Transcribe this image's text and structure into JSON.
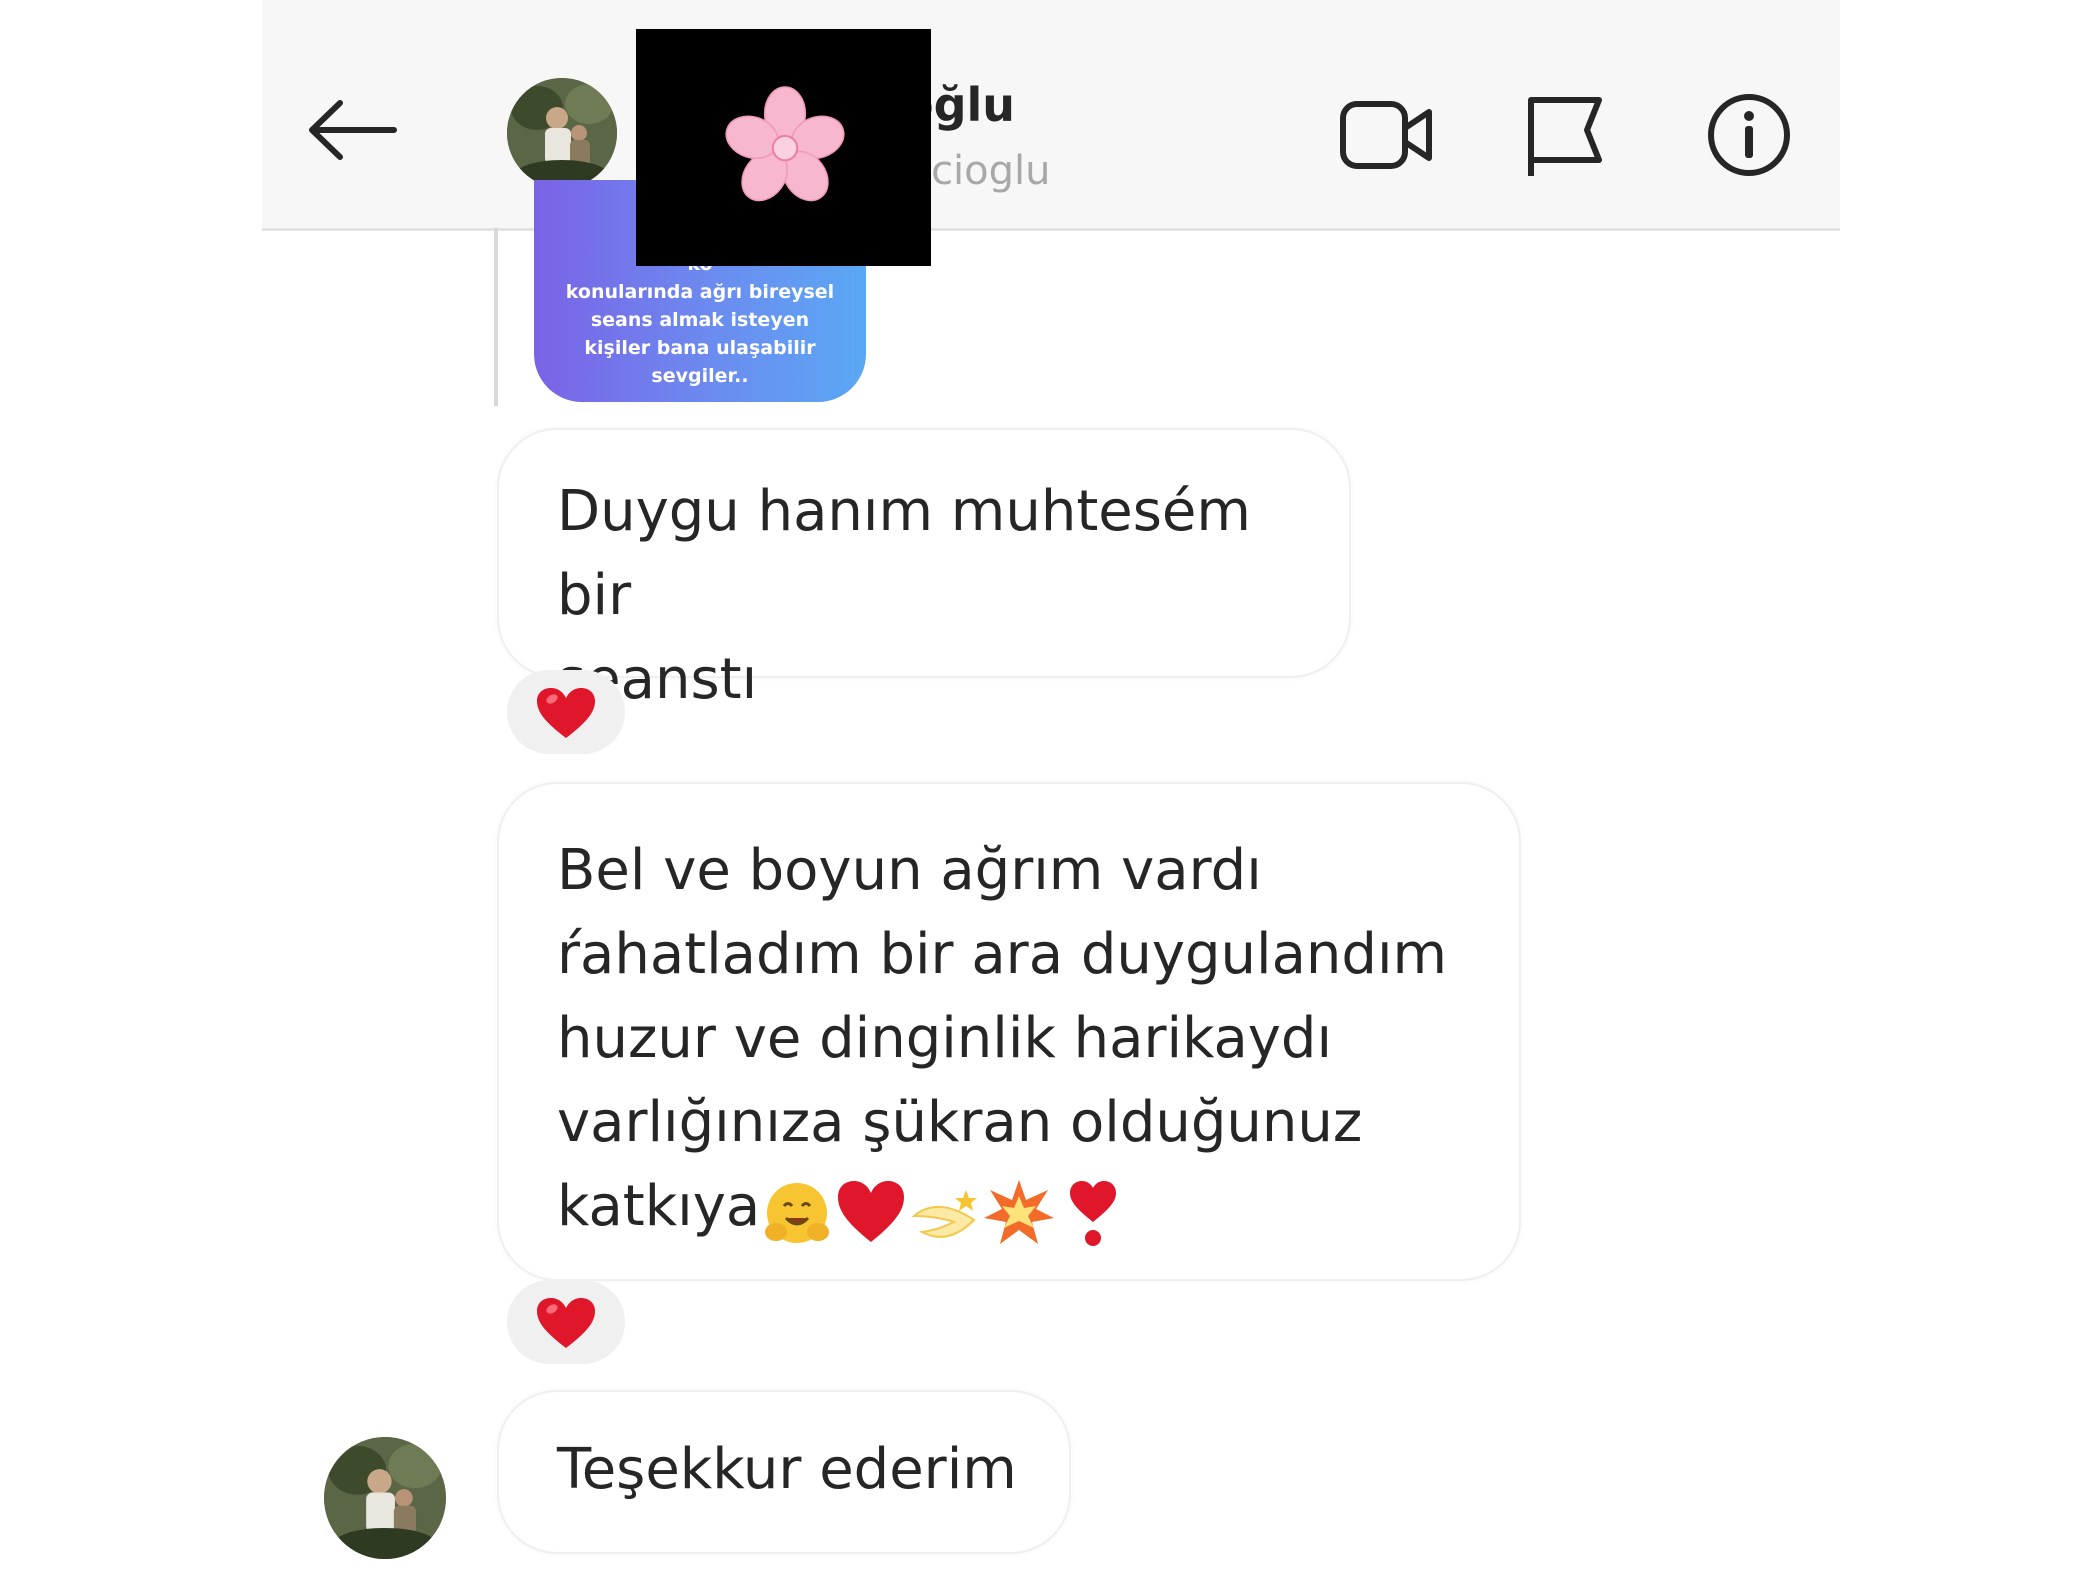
{
  "header": {
    "name_visible": "oğlu",
    "username_visible": "ftcioglu"
  },
  "icons": {
    "back": "arrow-left-icon",
    "video": "video-camera-icon",
    "flag": "flag-icon",
    "info": "info-icon",
    "redaction_sticker": "cherry-blossom-icon",
    "reaction": "red-heart-icon"
  },
  "story_reply": {
    "lines": [
      "ko",
      "konularında ağrı bireysel",
      "seans almak isteyen",
      "kişiler bana ulaşabilir",
      "sevgiler.."
    ]
  },
  "messages": [
    {
      "text": "Duygu hanım muhtesém bir\nseanstı",
      "reaction": "❤"
    },
    {
      "text": "Bel ve boyun ağrım vardı\nŕahatladım bir ara duygulandım\nhuzur ve dinginlik harikaydı\nvarlığınıza şükran olduğunuz\nkatkıya",
      "trailing_emojis": [
        "hugging-face",
        "red-heart",
        "dizzy",
        "collision",
        "exclamation-heart"
      ],
      "reaction": "❤"
    },
    {
      "text": "Teşekkur ederim"
    }
  ],
  "colors": {
    "header_bg": "#f7f7f7",
    "bubble_border": "#efefef",
    "text": "#262626",
    "muted": "#a8a8a8",
    "heart": "#e0162b",
    "story_gradient_start": "#7a63e6",
    "story_gradient_end": "#5aa8f4"
  }
}
